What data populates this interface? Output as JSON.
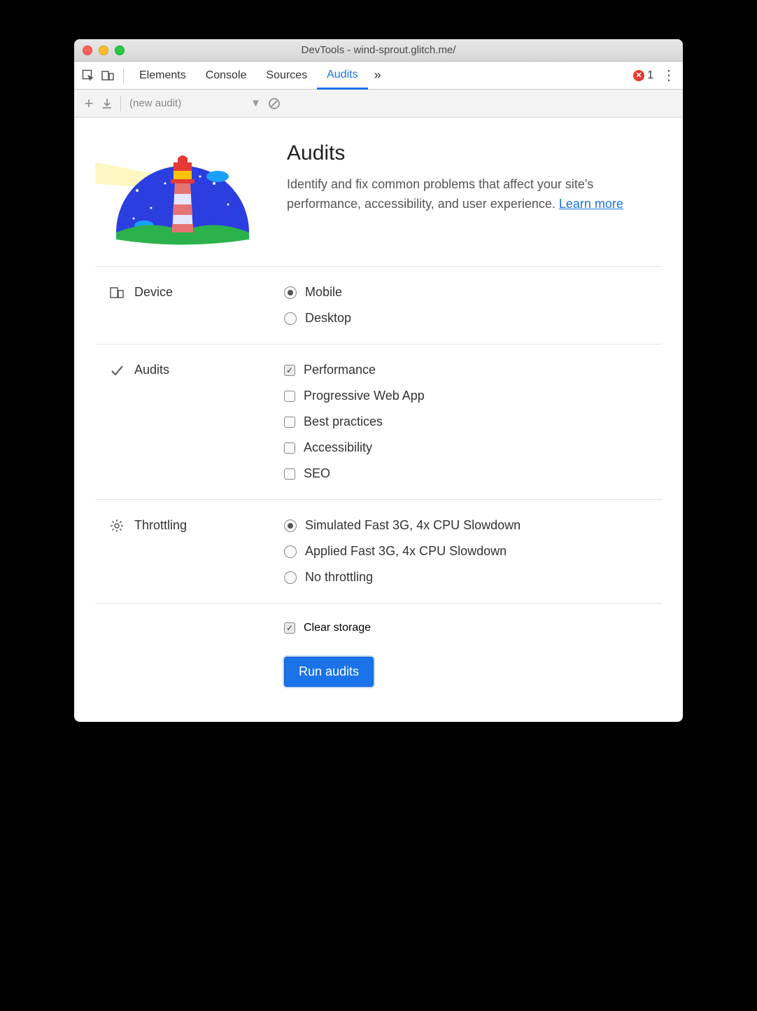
{
  "titlebar": {
    "title": "DevTools - wind-sprout.glitch.me/"
  },
  "tabs": {
    "items": [
      "Elements",
      "Console",
      "Sources",
      "Audits"
    ],
    "active_index": 3,
    "overflow_glyph": "»",
    "error_count": "1"
  },
  "toolbar": {
    "new_audit_label": "(new audit)"
  },
  "hero": {
    "title": "Audits",
    "description": "Identify and fix common problems that affect your site's performance, accessibility, and user experience. ",
    "learn_more": "Learn more"
  },
  "sections": {
    "device": {
      "label": "Device",
      "options": [
        {
          "label": "Mobile",
          "checked": true
        },
        {
          "label": "Desktop",
          "checked": false
        }
      ]
    },
    "audits": {
      "label": "Audits",
      "options": [
        {
          "label": "Performance",
          "checked": true
        },
        {
          "label": "Progressive Web App",
          "checked": false
        },
        {
          "label": "Best practices",
          "checked": false
        },
        {
          "label": "Accessibility",
          "checked": false
        },
        {
          "label": "SEO",
          "checked": false
        }
      ]
    },
    "throttling": {
      "label": "Throttling",
      "options": [
        {
          "label": "Simulated Fast 3G, 4x CPU Slowdown",
          "checked": true
        },
        {
          "label": "Applied Fast 3G, 4x CPU Slowdown",
          "checked": false
        },
        {
          "label": "No throttling",
          "checked": false
        }
      ]
    },
    "storage": {
      "clear_storage": {
        "label": "Clear storage",
        "checked": true
      }
    }
  },
  "run_button": "Run audits"
}
